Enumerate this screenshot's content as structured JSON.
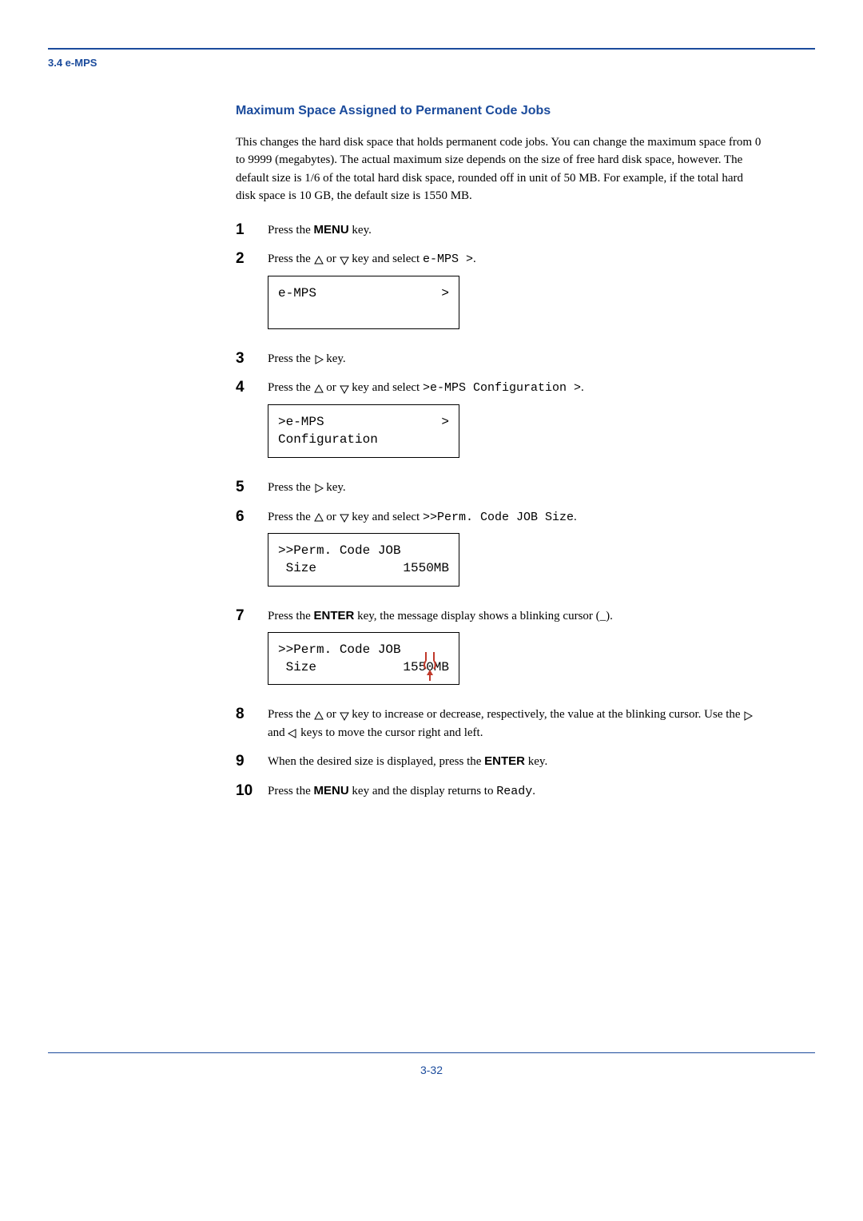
{
  "sectionLabel": "3.4 e-MPS",
  "pageNumber": "3-32",
  "heading": "Maximum Space Assigned to Permanent Code Jobs",
  "intro": "This changes the hard disk space that holds permanent code jobs. You can change the maximum space from 0 to 9999 (megabytes). The actual maximum size depends on the size of free hard disk space, however. The default size is 1/6 of the total hard disk space, rounded off in unit of 50 MB. For example, if the total hard disk space is 10 GB, the default size is 1550 MB.",
  "steps": {
    "s1": {
      "pre": "Press the ",
      "key": "MENU",
      "post": " key."
    },
    "s2": {
      "part1": "Press the ",
      "part2": " or ",
      "part3": " key and select ",
      "code": "e-MPS >",
      "end": "."
    },
    "lcd1": {
      "left": "e-MPS",
      "right": ">"
    },
    "s3": {
      "part1": "Press the ",
      "part2": " key."
    },
    "s4": {
      "part1": "Press the ",
      "part2": " or ",
      "part3": " key and select ",
      "code": ">e-MPS Configuration >",
      "end": "."
    },
    "lcd2": {
      "line1left": ">e-MPS",
      "line1right": ">",
      "line2": " Configuration"
    },
    "s5": {
      "part1": "Press the ",
      "part2": " key."
    },
    "s6": {
      "part1": "Press the ",
      "part2": " or ",
      "part3": " key and select ",
      "code": ">>Perm. Code JOB Size",
      "end": "."
    },
    "lcd3": {
      "line1": ">>Perm. Code JOB",
      "line2left": " Size",
      "line2right": "1550MB"
    },
    "s7": {
      "part1": "Press the ",
      "key": "ENTER",
      "part2": " key, the message display shows a blinking cursor (_)."
    },
    "lcd4": {
      "line1": ">>Perm. Code JOB",
      "line2left": " Size",
      "line2right": "1550MB"
    },
    "s8": {
      "part1": "Press the ",
      "part2": " or ",
      "part3": " key to increase or decrease, respectively, the value at the blinking cursor. Use the ",
      "part4": " and ",
      "part5": " keys to move the cursor right and left."
    },
    "s9": {
      "part1": "When the desired size is displayed, press the ",
      "key": "ENTER",
      "part2": " key."
    },
    "s10": {
      "part1": "Press the ",
      "key": "MENU",
      "part2": " key and the display returns to ",
      "code": "Ready",
      "end": "."
    }
  }
}
